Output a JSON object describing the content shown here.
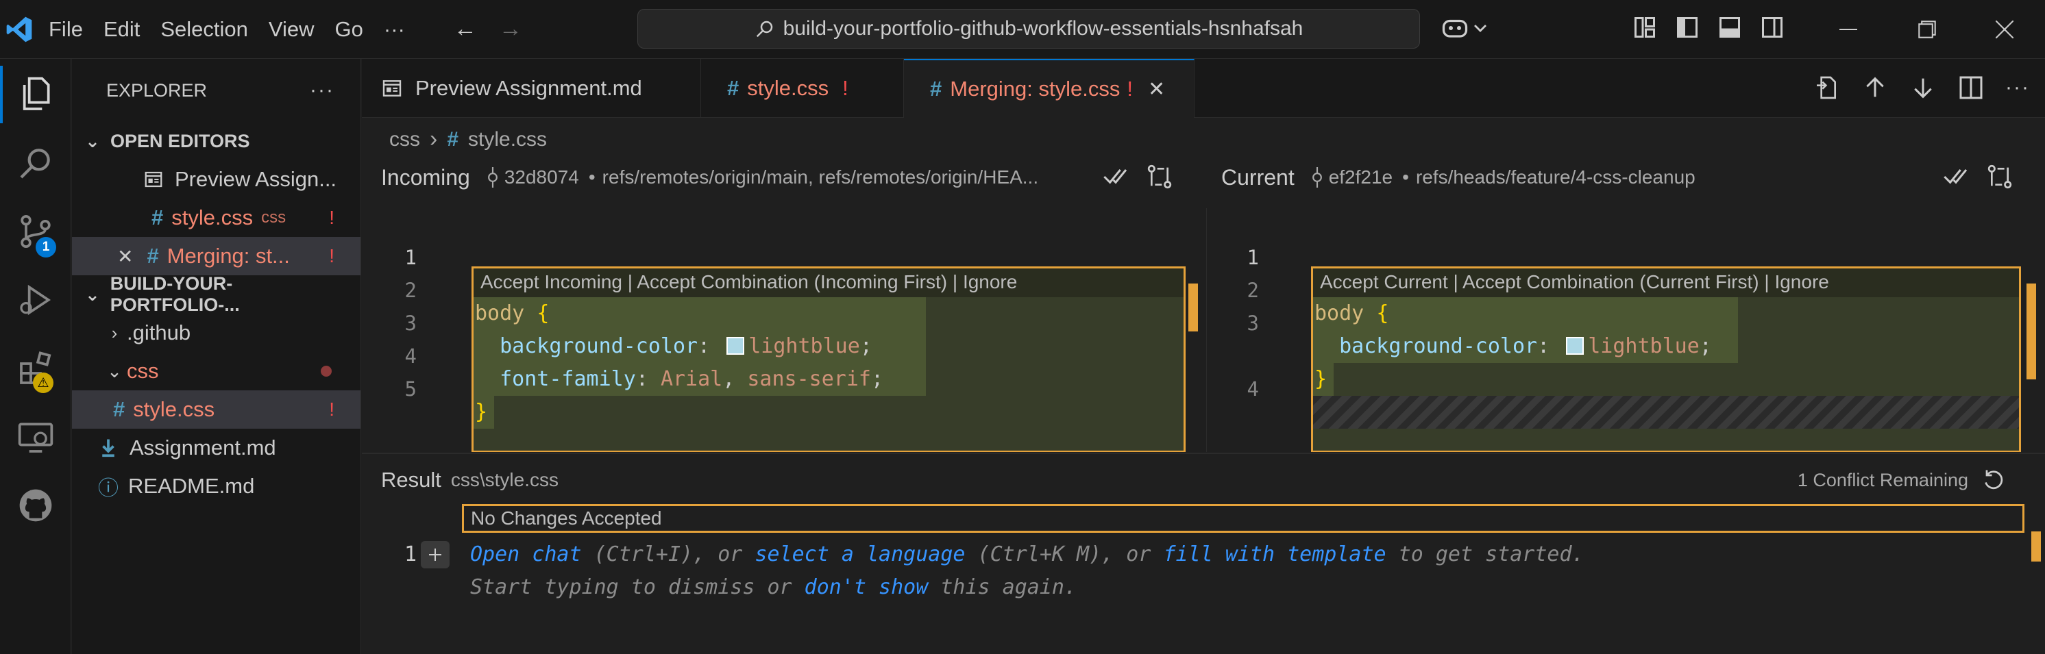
{
  "menu": [
    "File",
    "Edit",
    "Selection",
    "View",
    "Go",
    "···"
  ],
  "command_center": "build-your-portfolio-github-workflow-essentials-hsnhafsah",
  "activity": {
    "source_control_badge": "1"
  },
  "explorer": {
    "title": "EXPLORER",
    "open_editors_label": "OPEN EDITORS",
    "open_editors": [
      {
        "name": "Preview Assign...",
        "dim": "",
        "flag": ""
      },
      {
        "name": "style.css",
        "dim": "css",
        "flag": "!"
      },
      {
        "name": "Merging: st...",
        "dim": "",
        "flag": "!"
      }
    ],
    "workspace_label": "BUILD-YOUR-PORTFOLIO-...",
    "tree": {
      "github": ".github",
      "css": "css",
      "style": "style.css",
      "style_flag": "!",
      "assignment": "Assignment.md",
      "readme": "README.md"
    }
  },
  "tabs": [
    {
      "name": "Preview Assignment.md",
      "flag": ""
    },
    {
      "name": "style.css",
      "flag": "!"
    },
    {
      "name": "Merging: style.css",
      "flag": "!"
    }
  ],
  "breadcrumb": {
    "folder": "css",
    "file": "style.css"
  },
  "incoming": {
    "label": "Incoming",
    "commit": "32d8074",
    "refs": "refs/remotes/origin/main, refs/remotes/origin/HEA...",
    "actions": "Accept Incoming | Accept Combination (Incoming First) | Ignore",
    "line_numbers": [
      "1",
      "2",
      "3",
      "4",
      "5"
    ]
  },
  "current": {
    "label": "Current",
    "commit": "ef2f21e",
    "refs": "refs/heads/feature/4-css-cleanup",
    "actions": "Accept Current | Accept Combination (Current First) | Ignore",
    "line_numbers": [
      "1",
      "2",
      "3",
      "",
      "4"
    ]
  },
  "code": {
    "selector": "body",
    "open_brace": "{",
    "close_brace": "}",
    "prop1": "background-color",
    "val1": "lightblue",
    "prop2": "font-family",
    "val2a": "Arial",
    "val2b": "sans-serif",
    "colon": ":",
    "semicolon": ";",
    "comma": ","
  },
  "result": {
    "label": "Result",
    "path": "css\\style.css",
    "remaining": "1 Conflict Remaining",
    "status": "No Changes Accepted",
    "line_number": "1",
    "hint1_a": "Open chat",
    "hint1_b": " (Ctrl+I), or ",
    "hint1_c": "select a language",
    "hint1_d": " (Ctrl+K M), or ",
    "hint1_e": "fill with template",
    "hint1_f": " to get started.",
    "hint2_a": "Start typing to dismiss or ",
    "hint2_b": "don't show",
    "hint2_c": " this again."
  },
  "colors": {
    "accent": "#0078d4",
    "conflict_border": "#e5a23a",
    "modified": "#f48771"
  }
}
